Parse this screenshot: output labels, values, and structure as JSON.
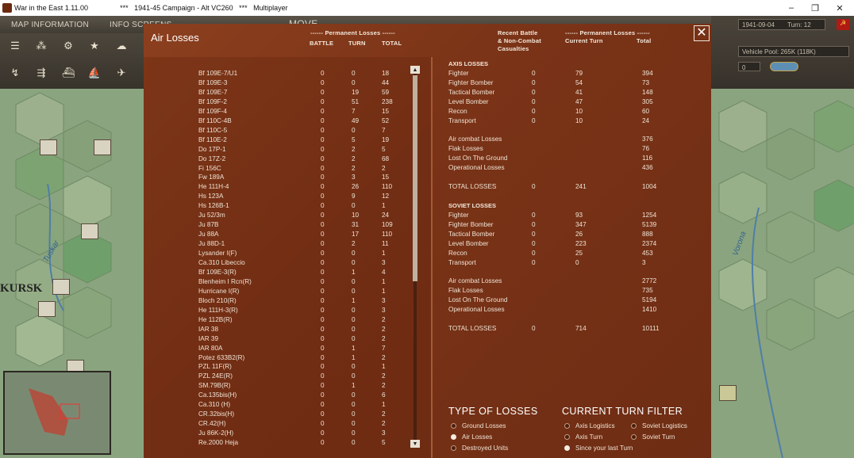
{
  "window": {
    "title": "War in the East 1.11.00",
    "subtitle": "***   1941-45 Campaign - Alt VC260   ***   Multiplayer",
    "min": "–",
    "max": "❐",
    "close": "✕"
  },
  "topbar": {
    "items": [
      "MAP INFORMATION",
      "INFO SCREENS",
      "MOVE"
    ]
  },
  "rightpanel": {
    "date": "1941-09-04",
    "turn": "Turn: 12",
    "vehicle_pool": "Vehicle Pool: 265K (118K)",
    "counter": "0"
  },
  "map": {
    "labels": {
      "kursk": "KURSK",
      "tuskar": "Tuskar",
      "vorona": "Vorona"
    }
  },
  "dialog": {
    "title": "Air Losses",
    "left_headers": {
      "group": "------ Permanent Losses ------",
      "battle": "BATTLE",
      "turn": "TURN",
      "total": "TOTAL"
    },
    "right_headers": {
      "recent1": "Recent Battle",
      "recent2": "& Non-Combat",
      "recent3": "Casualties",
      "group": "------ Permanent Losses ------",
      "current": "Current Turn",
      "total": "Total"
    },
    "rows": [
      [
        "Bf 109E-7/U1",
        "0",
        "0",
        "18"
      ],
      [
        "Bf 109E-3",
        "0",
        "0",
        "44"
      ],
      [
        "Bf 109E-7",
        "0",
        "19",
        "59"
      ],
      [
        "Bf 109F-2",
        "0",
        "51",
        "238"
      ],
      [
        "Bf 109F-4",
        "0",
        "7",
        "15"
      ],
      [
        "Bf 110C-4B",
        "0",
        "49",
        "52"
      ],
      [
        "Bf 110C-5",
        "0",
        "0",
        "7"
      ],
      [
        "Bf 110E-2",
        "0",
        "5",
        "19"
      ],
      [
        "Do 17P-1",
        "0",
        "2",
        "5"
      ],
      [
        "Do 17Z-2",
        "0",
        "2",
        "68"
      ],
      [
        "Fi 156C",
        "0",
        "2",
        "2"
      ],
      [
        "Fw 189A",
        "0",
        "3",
        "15"
      ],
      [
        "He 111H-4",
        "0",
        "26",
        "110"
      ],
      [
        "Hs 123A",
        "0",
        "9",
        "12"
      ],
      [
        "Hs 126B-1",
        "0",
        "0",
        "1"
      ],
      [
        "Ju 52/3m",
        "0",
        "10",
        "24"
      ],
      [
        "Ju 87B",
        "0",
        "31",
        "109"
      ],
      [
        "Ju 88A",
        "0",
        "17",
        "110"
      ],
      [
        "Ju 88D-1",
        "0",
        "2",
        "11"
      ],
      [
        "Lysander I(F)",
        "0",
        "0",
        "1"
      ],
      [
        "Ca.310 Libeccio",
        "0",
        "0",
        "3"
      ],
      [
        "Bf 109E-3(R)",
        "0",
        "1",
        "4"
      ],
      [
        "Blenheim I Rcn(R)",
        "0",
        "0",
        "1"
      ],
      [
        "Hurricane I(R)",
        "0",
        "0",
        "1"
      ],
      [
        "Bloch 210(R)",
        "0",
        "1",
        "3"
      ],
      [
        "He 111H-3(R)",
        "0",
        "0",
        "3"
      ],
      [
        "He 112B(R)",
        "0",
        "0",
        "2"
      ],
      [
        "IAR 38",
        "0",
        "0",
        "2"
      ],
      [
        "IAR 39",
        "0",
        "0",
        "2"
      ],
      [
        "IAR 80A",
        "0",
        "1",
        "7"
      ],
      [
        "Potez 633B2(R)",
        "0",
        "1",
        "2"
      ],
      [
        "PZL 11F(R)",
        "0",
        "0",
        "1"
      ],
      [
        "PZL 24E(R)",
        "0",
        "0",
        "2"
      ],
      [
        "SM.79B(R)",
        "0",
        "1",
        "2"
      ],
      [
        "Ca.135bis(H)",
        "0",
        "0",
        "6"
      ],
      [
        "Ca.310 (H)",
        "0",
        "0",
        "1"
      ],
      [
        "CR.32bis(H)",
        "0",
        "0",
        "2"
      ],
      [
        "CR.42(H)",
        "0",
        "0",
        "2"
      ],
      [
        "Ju 86K-2(H)",
        "0",
        "0",
        "3"
      ],
      [
        "Re.2000 Heja",
        "0",
        "0",
        "5"
      ]
    ],
    "axis_title": "AXIS LOSSES",
    "axis_rows": [
      [
        "Fighter",
        "0",
        "79",
        "394"
      ],
      [
        "Fighter Bomber",
        "0",
        "54",
        "73"
      ],
      [
        "Tactical Bomber",
        "0",
        "41",
        "148"
      ],
      [
        "Level Bomber",
        "0",
        "47",
        "305"
      ],
      [
        "Recon",
        "0",
        "10",
        "60"
      ],
      [
        "Transport",
        "0",
        "10",
        "24"
      ]
    ],
    "axis_other": [
      [
        "Air combat Losses",
        "376"
      ],
      [
        "Flak Losses",
        "76"
      ],
      [
        "Lost On The Ground",
        "116"
      ],
      [
        "Operational Losses",
        "436"
      ]
    ],
    "axis_total": [
      "TOTAL LOSSES",
      "0",
      "241",
      "1004"
    ],
    "soviet_title": "SOVIET LOSSES",
    "soviet_rows": [
      [
        "Fighter",
        "0",
        "93",
        "1254"
      ],
      [
        "Fighter Bomber",
        "0",
        "347",
        "5139"
      ],
      [
        "Tactical Bomber",
        "0",
        "26",
        "888"
      ],
      [
        "Level Bomber",
        "0",
        "223",
        "2374"
      ],
      [
        "Recon",
        "0",
        "25",
        "453"
      ],
      [
        "Transport",
        "0",
        "0",
        "3"
      ]
    ],
    "soviet_other": [
      [
        "Air combat Losses",
        "2772"
      ],
      [
        "Flak Losses",
        "735"
      ],
      [
        "Lost On The Ground",
        "5194"
      ],
      [
        "Operational Losses",
        "1410"
      ]
    ],
    "soviet_total": [
      "TOTAL LOSSES",
      "0",
      "714",
      "10111"
    ],
    "type_title": "TYPE OF LOSSES",
    "type_options": [
      "Ground Losses",
      "Air Losses",
      "Destroyed Units"
    ],
    "type_selected": "Air Losses",
    "filter_title": "CURRENT TURN FILTER",
    "filter_options": [
      "Axis Logistics",
      "Soviet Logistics",
      "Axis Turn",
      "Soviet Turn",
      "Since your last Turn"
    ],
    "filter_selected": "Since your last Turn"
  }
}
